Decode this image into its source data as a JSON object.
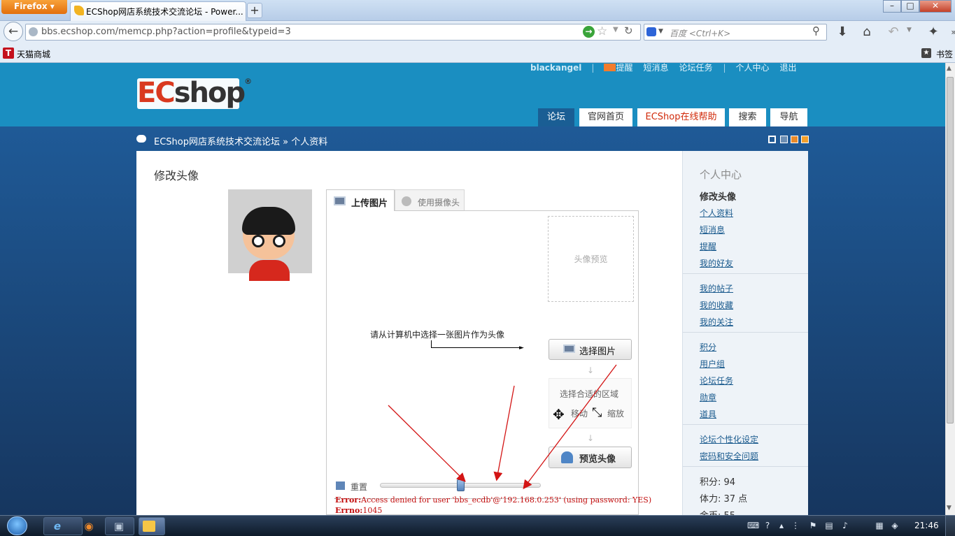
{
  "browser": {
    "app_button": "Firefox",
    "tab_title": "ECShop网店系统技术交流论坛 - Power...",
    "url": "bbs.ecshop.com/memcp.php?action=profile&typeid=3",
    "search_placeholder": "百度 <Ctrl+K>",
    "bookmarks": [
      {
        "label": "天猫商城",
        "icon_text": "T"
      },
      {
        "label": "书签"
      }
    ]
  },
  "site": {
    "logo_ec": "EC",
    "logo_shop": "shop",
    "logo_reg": "®",
    "topnav": {
      "username": "blackangel",
      "items": [
        "提醒",
        "短消息",
        "论坛任务",
        "个人中心",
        "退出"
      ]
    },
    "tabs": [
      "论坛",
      "官网首页",
      "ECShop在线帮助",
      "搜索",
      "导航"
    ],
    "breadcrumb": "ECShop网店系统技术交流论坛 » 个人资料"
  },
  "main": {
    "heading": "修改头像",
    "upload_tabs": [
      "上传图片",
      "使用摄像头"
    ],
    "preview_placeholder": "头像预览",
    "instruction": "请从计算机中选择一张图片作为头像",
    "choose_button": "选择图片",
    "select_area_title": "选择合适的区域",
    "move_label": "移动",
    "zoom_label": "缩放",
    "preview_button": "预览头像",
    "reset_label": "重置",
    "slider_position_fraction": 0.5,
    "error_label": "Error:",
    "error_text": "Access denied for user 'bbs_ecdb'@'192.168.0.253' (using password: YES)",
    "errno_label": "Errno:",
    "errno_value": "1045"
  },
  "sidebar": {
    "title": "个人中心",
    "current": "修改头像",
    "group1": [
      "个人资料",
      "短消息",
      "提醒",
      "我的好友"
    ],
    "group2": [
      "我的帖子",
      "我的收藏",
      "我的关注"
    ],
    "group3": [
      "积分",
      "用户组",
      "论坛任务",
      "勋章",
      "道具"
    ],
    "group4": [
      "论坛个性化设定",
      "密码和安全问题"
    ],
    "stats": [
      "积分: 94",
      "体力: 37 点",
      "金币: 55"
    ]
  },
  "taskbar": {
    "clock": "21:46"
  },
  "colors": {
    "header_bg": "#1a8ec1",
    "active_tab": "#1a5e94",
    "help_tab_text": "#d12a0a",
    "error_text": "#c20c0c",
    "link": "#1b5b8e"
  }
}
